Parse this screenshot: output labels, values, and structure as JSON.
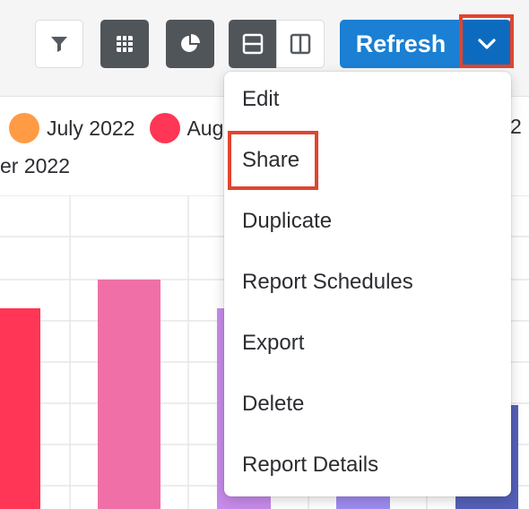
{
  "toolbar": {
    "refresh_label": "Refresh"
  },
  "legend": {
    "items": [
      {
        "label": "July 2022",
        "color": "#ff9b45"
      },
      {
        "label": "Aug",
        "color": "#ff3655"
      }
    ],
    "right_fragment": "2",
    "row2_fragment": "er 2022"
  },
  "chart_colors": [
    "#ff3655",
    "#f06fa7",
    "#c78bea",
    "#9e8cf0",
    "#5560b8"
  ],
  "menu": {
    "items": [
      "Edit",
      "Share",
      "Duplicate",
      "Report Schedules",
      "Export",
      "Delete",
      "Report Details"
    ]
  },
  "highlight_color": "#e0452f"
}
